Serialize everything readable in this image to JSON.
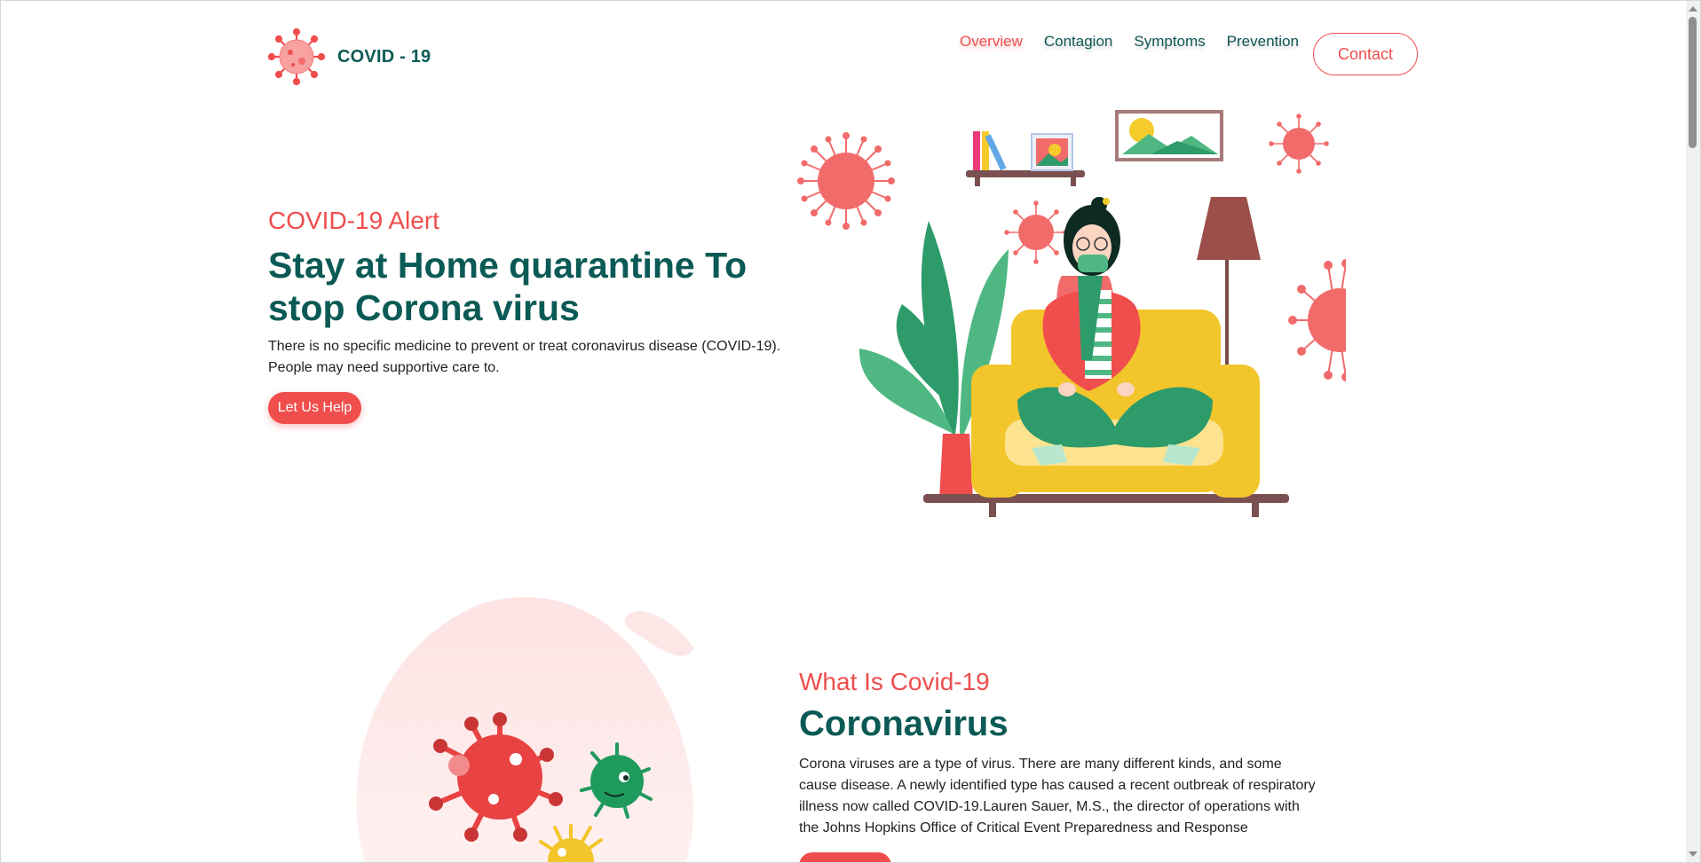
{
  "brand": {
    "name": "COVID - 19",
    "logo_icon": "virus-icon"
  },
  "nav": {
    "items": [
      {
        "label": "Overview",
        "active": true
      },
      {
        "label": "Contagion",
        "active": false
      },
      {
        "label": "Symptoms",
        "active": false
      },
      {
        "label": "Prevention",
        "active": false
      }
    ],
    "contact_label": "Contact"
  },
  "hero": {
    "kicker": "COVID-19 Alert",
    "title": "Stay at Home quarantine To stop Corona virus",
    "description": "There is no specific medicine to prevent or treat coronavirus disease (COVID-19). People may need supportive care to.",
    "cta_label": "Let Us Help",
    "illustration": "woman-on-sofa-illustration"
  },
  "about": {
    "kicker": "What Is Covid-19",
    "title": "Coronavirus",
    "description": "Corona viruses are a type of virus. There are many different kinds, and some cause disease. A newly identified type has caused a recent outbreak of respiratory illness now called COVID-19.Lauren Sauer, M.S., the director of operations with the Johns Hopkins Office of Critical Event Preparedness and Response",
    "illustration": "virus-characters-illustration"
  },
  "colors": {
    "accent": "#f04d4d",
    "primary": "#0b5a55",
    "sofa": "#f2c52b",
    "plant": "#2e9b6a"
  }
}
